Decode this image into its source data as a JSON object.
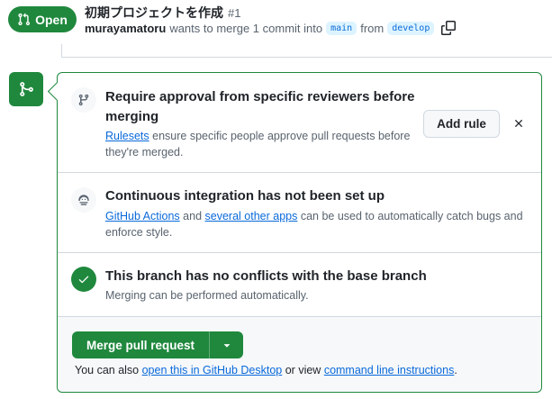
{
  "header": {
    "state_label": "Open",
    "title": "初期プロジェクトを作成",
    "number": "#1",
    "author": "murayamatoru",
    "meta_text": "wants to merge 1 commit into",
    "base_branch": "main",
    "from_text": "from",
    "head_branch": "develop"
  },
  "approval": {
    "title": "Require approval from specific reviewers before merging",
    "link_text": "Rulesets",
    "desc_text": "ensure specific people approve pull requests before they're merged.",
    "add_rule_label": "Add rule"
  },
  "ci": {
    "title": "Continuous integration has not been set up",
    "link1": "GitHub Actions",
    "and_text": "and",
    "link2": "several other apps",
    "desc_text": "can be used to automatically catch bugs and enforce style."
  },
  "conflicts": {
    "title": "This branch has no conflicts with the base branch",
    "desc": "Merging can be performed automatically."
  },
  "footer": {
    "merge_label": "Merge pull request",
    "note_prefix": "You can also",
    "link_desktop": "open this in GitHub Desktop",
    "note_mid": "or view",
    "link_cli": "command line instructions",
    "note_suffix": "."
  },
  "colors": {
    "success": "#1f883d",
    "link": "#0969da",
    "branch_bg": "#ddf4ff"
  }
}
